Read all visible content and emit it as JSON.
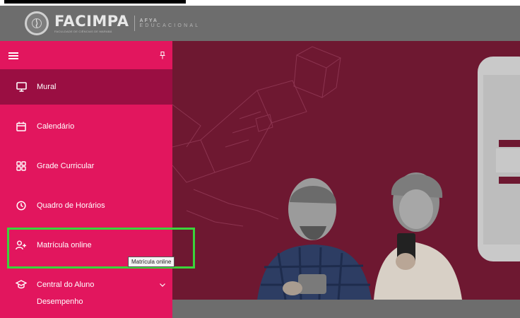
{
  "header": {
    "brand": "FACIMPA",
    "brand_sub": "FACULDADE DE CIÊNCIAS DE MARABÁ",
    "partner_top": "AFYA",
    "partner_bottom": "EDUCACIONAL"
  },
  "sidebar": {
    "items": [
      {
        "label": "Mural",
        "icon": "monitor-icon"
      },
      {
        "label": "Calendário",
        "icon": "calendar-icon"
      },
      {
        "label": "Grade Curricular",
        "icon": "grid-icon"
      },
      {
        "label": "Quadro de Horários",
        "icon": "clock-icon"
      },
      {
        "label": "Matrícula online",
        "icon": "add-user-icon"
      },
      {
        "label": "Central do Aluno",
        "icon": "graduation-cap-icon"
      }
    ],
    "submenu_item": "Desempenho"
  },
  "tooltip": "Matrícula online",
  "colors": {
    "sidebar": "#e2165e",
    "sidebar_active": "#9a0e42",
    "header": "#6d6d6d",
    "banner": "#6e1831",
    "highlight": "#3bd43b"
  }
}
